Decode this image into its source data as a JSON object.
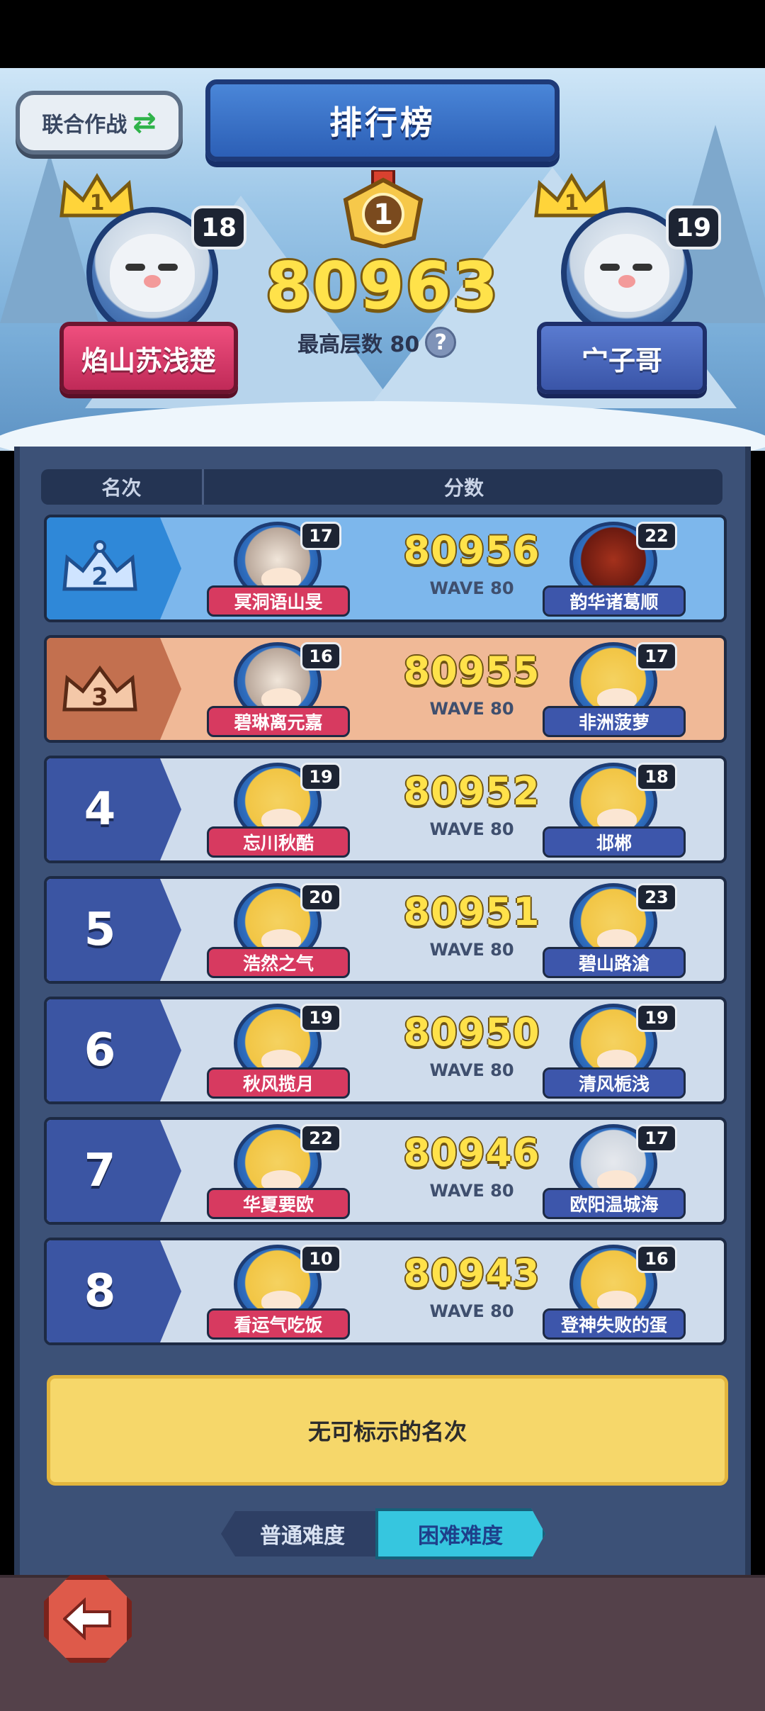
{
  "header": {
    "title": "排行榜",
    "coop_label": "联合作战"
  },
  "top": {
    "rank": "1",
    "score": "80963",
    "max_floor_label": "最高层数 80",
    "help_icon": "?",
    "left_player": {
      "name": "焰山苏浅楚",
      "level": "18",
      "crown_rank": "1"
    },
    "right_player": {
      "name": "宀子哥",
      "level": "19",
      "crown_rank": "1"
    }
  },
  "columns": {
    "rank": "名次",
    "score": "分数"
  },
  "rows": [
    {
      "rank": "2",
      "score": "80956",
      "wave": "WAVE 80",
      "left": {
        "name": "冥洞语山旻",
        "level": "17"
      },
      "right": {
        "name": "韵华诸葛顺",
        "level": "22"
      }
    },
    {
      "rank": "3",
      "score": "80955",
      "wave": "WAVE 80",
      "left": {
        "name": "碧琳离元嘉",
        "level": "16"
      },
      "right": {
        "name": "非洲菠萝",
        "level": "17"
      }
    },
    {
      "rank": "4",
      "score": "80952",
      "wave": "WAVE 80",
      "left": {
        "name": "忘川秋酷",
        "level": "19"
      },
      "right": {
        "name": "邶郴",
        "level": "18"
      }
    },
    {
      "rank": "5",
      "score": "80951",
      "wave": "WAVE 80",
      "left": {
        "name": "浩然之气",
        "level": "20"
      },
      "right": {
        "name": "碧山路滄",
        "level": "23"
      }
    },
    {
      "rank": "6",
      "score": "80950",
      "wave": "WAVE 80",
      "left": {
        "name": "秋风揽月",
        "level": "19"
      },
      "right": {
        "name": "清风栀浅",
        "level": "19"
      }
    },
    {
      "rank": "7",
      "score": "80946",
      "wave": "WAVE 80",
      "left": {
        "name": "华夏要欧",
        "level": "22"
      },
      "right": {
        "name": "欧阳温城海",
        "level": "17"
      }
    },
    {
      "rank": "8",
      "score": "80943",
      "wave": "WAVE 80",
      "left": {
        "name": "看运气吃饭",
        "level": "10"
      },
      "right": {
        "name": "登神失败的蛋",
        "level": "16"
      }
    }
  ],
  "my_rank": "无可标示的名次",
  "difficulty": {
    "normal": "普通难度",
    "hard": "困难难度",
    "selected": "困难难度"
  },
  "colors": {
    "gold": "#ffe24a",
    "rank2": "#2f88d8",
    "rank3": "#c3704f",
    "plain": "#3b55a3"
  }
}
